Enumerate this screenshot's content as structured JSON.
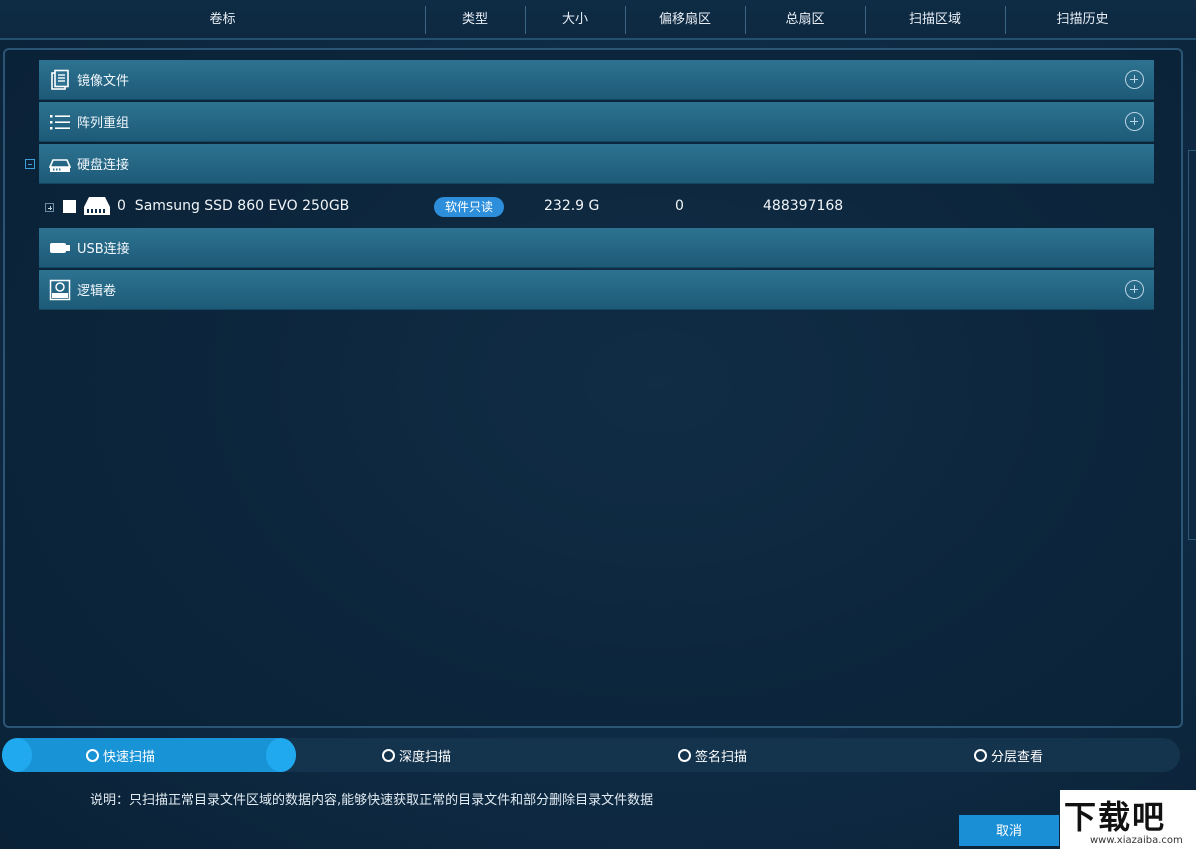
{
  "header": {
    "columns": [
      "卷标",
      "类型",
      "大小",
      "偏移扇区",
      "总扇区",
      "扫描区域",
      "扫描历史"
    ]
  },
  "tree": {
    "image_files": {
      "label": "镜像文件",
      "icon": "image-file-icon"
    },
    "raid": {
      "label": "阵列重组",
      "icon": "list-icon"
    },
    "disk_connect": {
      "label": "硬盘连接",
      "icon": "hard-disk-icon"
    },
    "usb_connect": {
      "label": "USB连接",
      "icon": "usb-icon"
    },
    "lvm": {
      "label": "逻辑卷",
      "icon": "lvm-icon"
    }
  },
  "disk": {
    "name": "0  Samsung SSD 860 EVO 250GB",
    "badge": "软件只读",
    "size": "232.9 G",
    "offset": "0",
    "total_sectors": "488397168"
  },
  "scan_modes": [
    {
      "label": "快速扫描",
      "selected": true
    },
    {
      "label": "深度扫描",
      "selected": false
    },
    {
      "label": "签名扫描",
      "selected": false
    },
    {
      "label": "分层查看",
      "selected": false
    }
  ],
  "description": "说明：只扫描正常目录文件区域的数据内容,能够快速获取正常的目录文件和部分删除目录文件数据",
  "buttons": {
    "cancel": "取消"
  },
  "watermark": {
    "title": "下载吧",
    "url": "www.xiazaiba.com"
  },
  "colors": {
    "accent": "#1793d6",
    "row": "#2d7391",
    "background": "#0f2d47"
  }
}
